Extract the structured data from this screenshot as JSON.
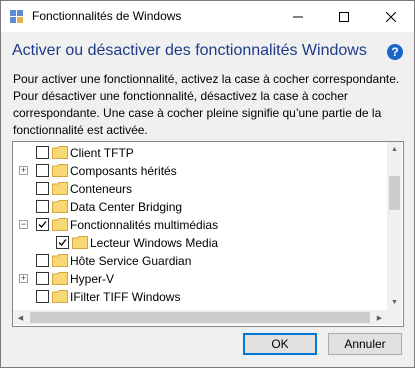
{
  "window": {
    "title": "Fonctionnalités de Windows",
    "controls": {
      "minimize": "—",
      "maximize": "☐",
      "close": "✕"
    }
  },
  "header": {
    "title": "Activer ou désactiver des fonctionnalités Windows",
    "help": "?"
  },
  "description": "Pour activer une fonctionnalité, activez la case à cocher correspondante. Pour désactiver une fonctionnalité, désactivez la case à cocher correspondante. Une case à cocher pleine signifie qu’une partie de la fonctionnalité est activée.",
  "features": [
    {
      "label": "Client TFTP",
      "checked": false,
      "expandable": false,
      "level": 0
    },
    {
      "label": "Composants hérités",
      "checked": false,
      "expandable": true,
      "expanded": false,
      "level": 0
    },
    {
      "label": "Conteneurs",
      "checked": false,
      "expandable": false,
      "level": 0
    },
    {
      "label": "Data Center Bridging",
      "checked": false,
      "expandable": false,
      "level": 0
    },
    {
      "label": "Fonctionnalités multimédias",
      "checked": true,
      "expandable": true,
      "expanded": true,
      "level": 0
    },
    {
      "label": "Lecteur Windows Media",
      "checked": true,
      "expandable": false,
      "level": 1
    },
    {
      "label": "Hôte Service Guardian",
      "checked": false,
      "expandable": false,
      "level": 0
    },
    {
      "label": "Hyper-V",
      "checked": false,
      "expandable": true,
      "expanded": false,
      "level": 0
    },
    {
      "label": "IFilter TIFF Windows",
      "checked": false,
      "expandable": false,
      "level": 0
    }
  ],
  "buttons": {
    "ok": "OK",
    "cancel": "Annuler"
  },
  "colors": {
    "accent": "#0078d7",
    "header": "#1e3b8a",
    "help": "#1b64c8",
    "folder": "#f8d775"
  }
}
